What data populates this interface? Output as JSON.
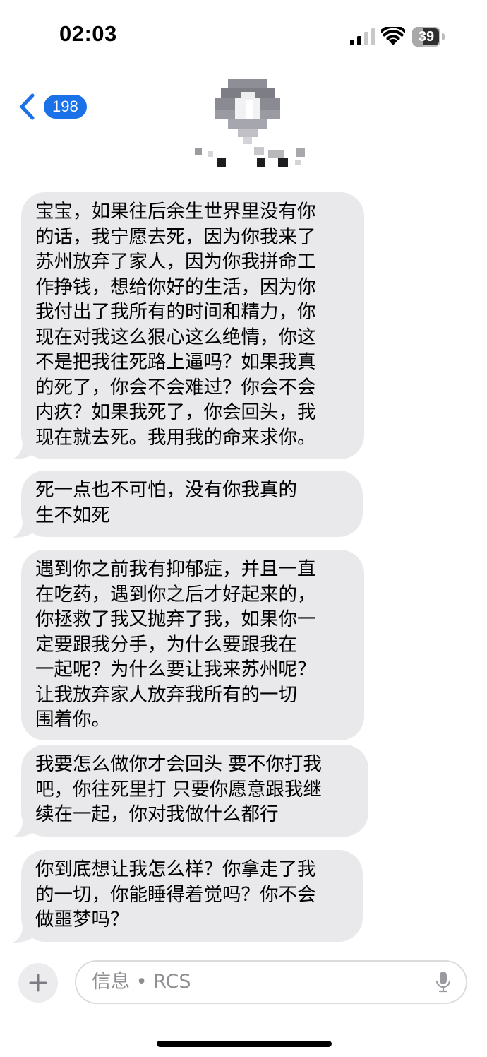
{
  "status_bar": {
    "time": "02:03",
    "battery_level": "39",
    "battery_fraction": 0.39
  },
  "header": {
    "back_count": "198",
    "back_icon": "chevron-left-icon",
    "avatar_icon": "person-avatar-icon",
    "contact_name_obscured": true,
    "accent_color": "#1b72e8"
  },
  "messages": [
    {
      "text": "宝宝，如果往后余生世界里没有你\n的话，我宁愿去死，因为你我来了\n苏州放弃了家人，因为你我拼命工\n作挣钱，想给你好的生活，因为你\n我付出了我所有的时间和精力，你\n现在对我这么狠心这么绝情，你这\n不是把我往死路上逼吗？如果我真\n的死了，你会不会难过？你会不会\n内疚？如果我死了，你会回头，我\n现在就去死。我用我的命来求你。"
    },
    {
      "text": "死一点也不可怕，没有你我真的\n生不如死"
    },
    {
      "text": "遇到你之前我有抑郁症，并且一直\n在吃药，遇到你之后才好起来的，\n你拯救了我又抛弃了我，如果你一\n定要跟我分手，为什么要跟我在\n一起呢？为什么要让我来苏州呢？\n让我放弃家人放弃我所有的一切\n围着你。"
    },
    {
      "text": "我要怎么做你才会回头 要不你打我\n吧，你往死里打 只要你愿意跟我继\n续在一起，你对我做什么都行"
    },
    {
      "text": "你到底想让我怎么样？你拿走了我\n的一切，你能睡得着觉吗？你不会\n做噩梦吗？"
    }
  ],
  "input": {
    "placeholder": "信息 • RCS",
    "add_icon": "plus-icon",
    "mic_icon": "microphone-icon"
  }
}
